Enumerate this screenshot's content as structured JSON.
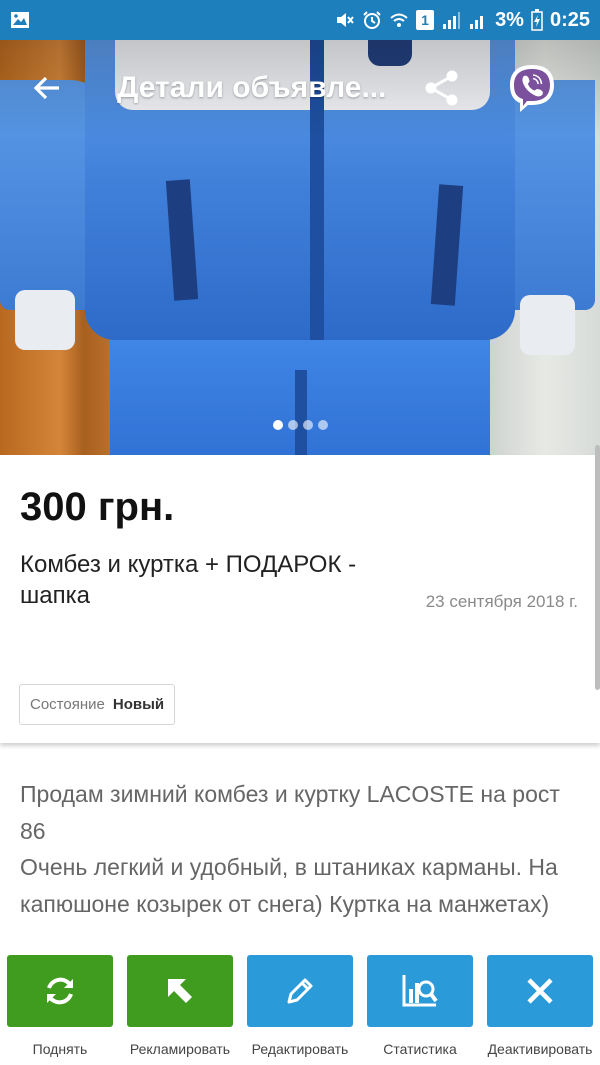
{
  "status_bar": {
    "battery": "3%",
    "time": "0:25",
    "sim_indicator": "1",
    "icons": [
      "gallery-notification-icon",
      "mute-icon",
      "alarm-icon",
      "wifi-icon",
      "sim-icon",
      "signal-icon",
      "battery-charging-icon"
    ]
  },
  "toolbar": {
    "title": "Детали объявле..."
  },
  "gallery": {
    "dots": 4,
    "active_index": 0
  },
  "listing": {
    "price": "300 грн.",
    "title": "Комбез и куртка + ПОДАРОК - шапка",
    "date": "23 сентября 2018 г.",
    "condition_label": "Состояние",
    "condition_value": "Новый"
  },
  "description": {
    "lines": [
      "Продам зимний комбез и куртку LACOSTE на рост 86",
      "Очень легкий и удобный, в штаниках карманы. На капюшоне козырек от снега) Куртка на манжетах)"
    ]
  },
  "actions": [
    {
      "label": "Поднять",
      "icon": "refresh-icon",
      "color": "#3f9c1e"
    },
    {
      "label": "Рекламировать",
      "icon": "cursor-arrow-icon",
      "color": "#3f9c1e"
    },
    {
      "label": "Редактировать",
      "icon": "pencil-icon",
      "color": "#2a9bd8"
    },
    {
      "label": "Статистика",
      "icon": "statistics-icon",
      "color": "#2a9bd8"
    },
    {
      "label": "Деактивировать",
      "icon": "close-icon",
      "color": "#2a9bd8"
    }
  ],
  "colors": {
    "status_bar": "#1e7fbd",
    "green": "#3f9c1e",
    "blue": "#2a9bd8",
    "viber": "#7b519d"
  }
}
